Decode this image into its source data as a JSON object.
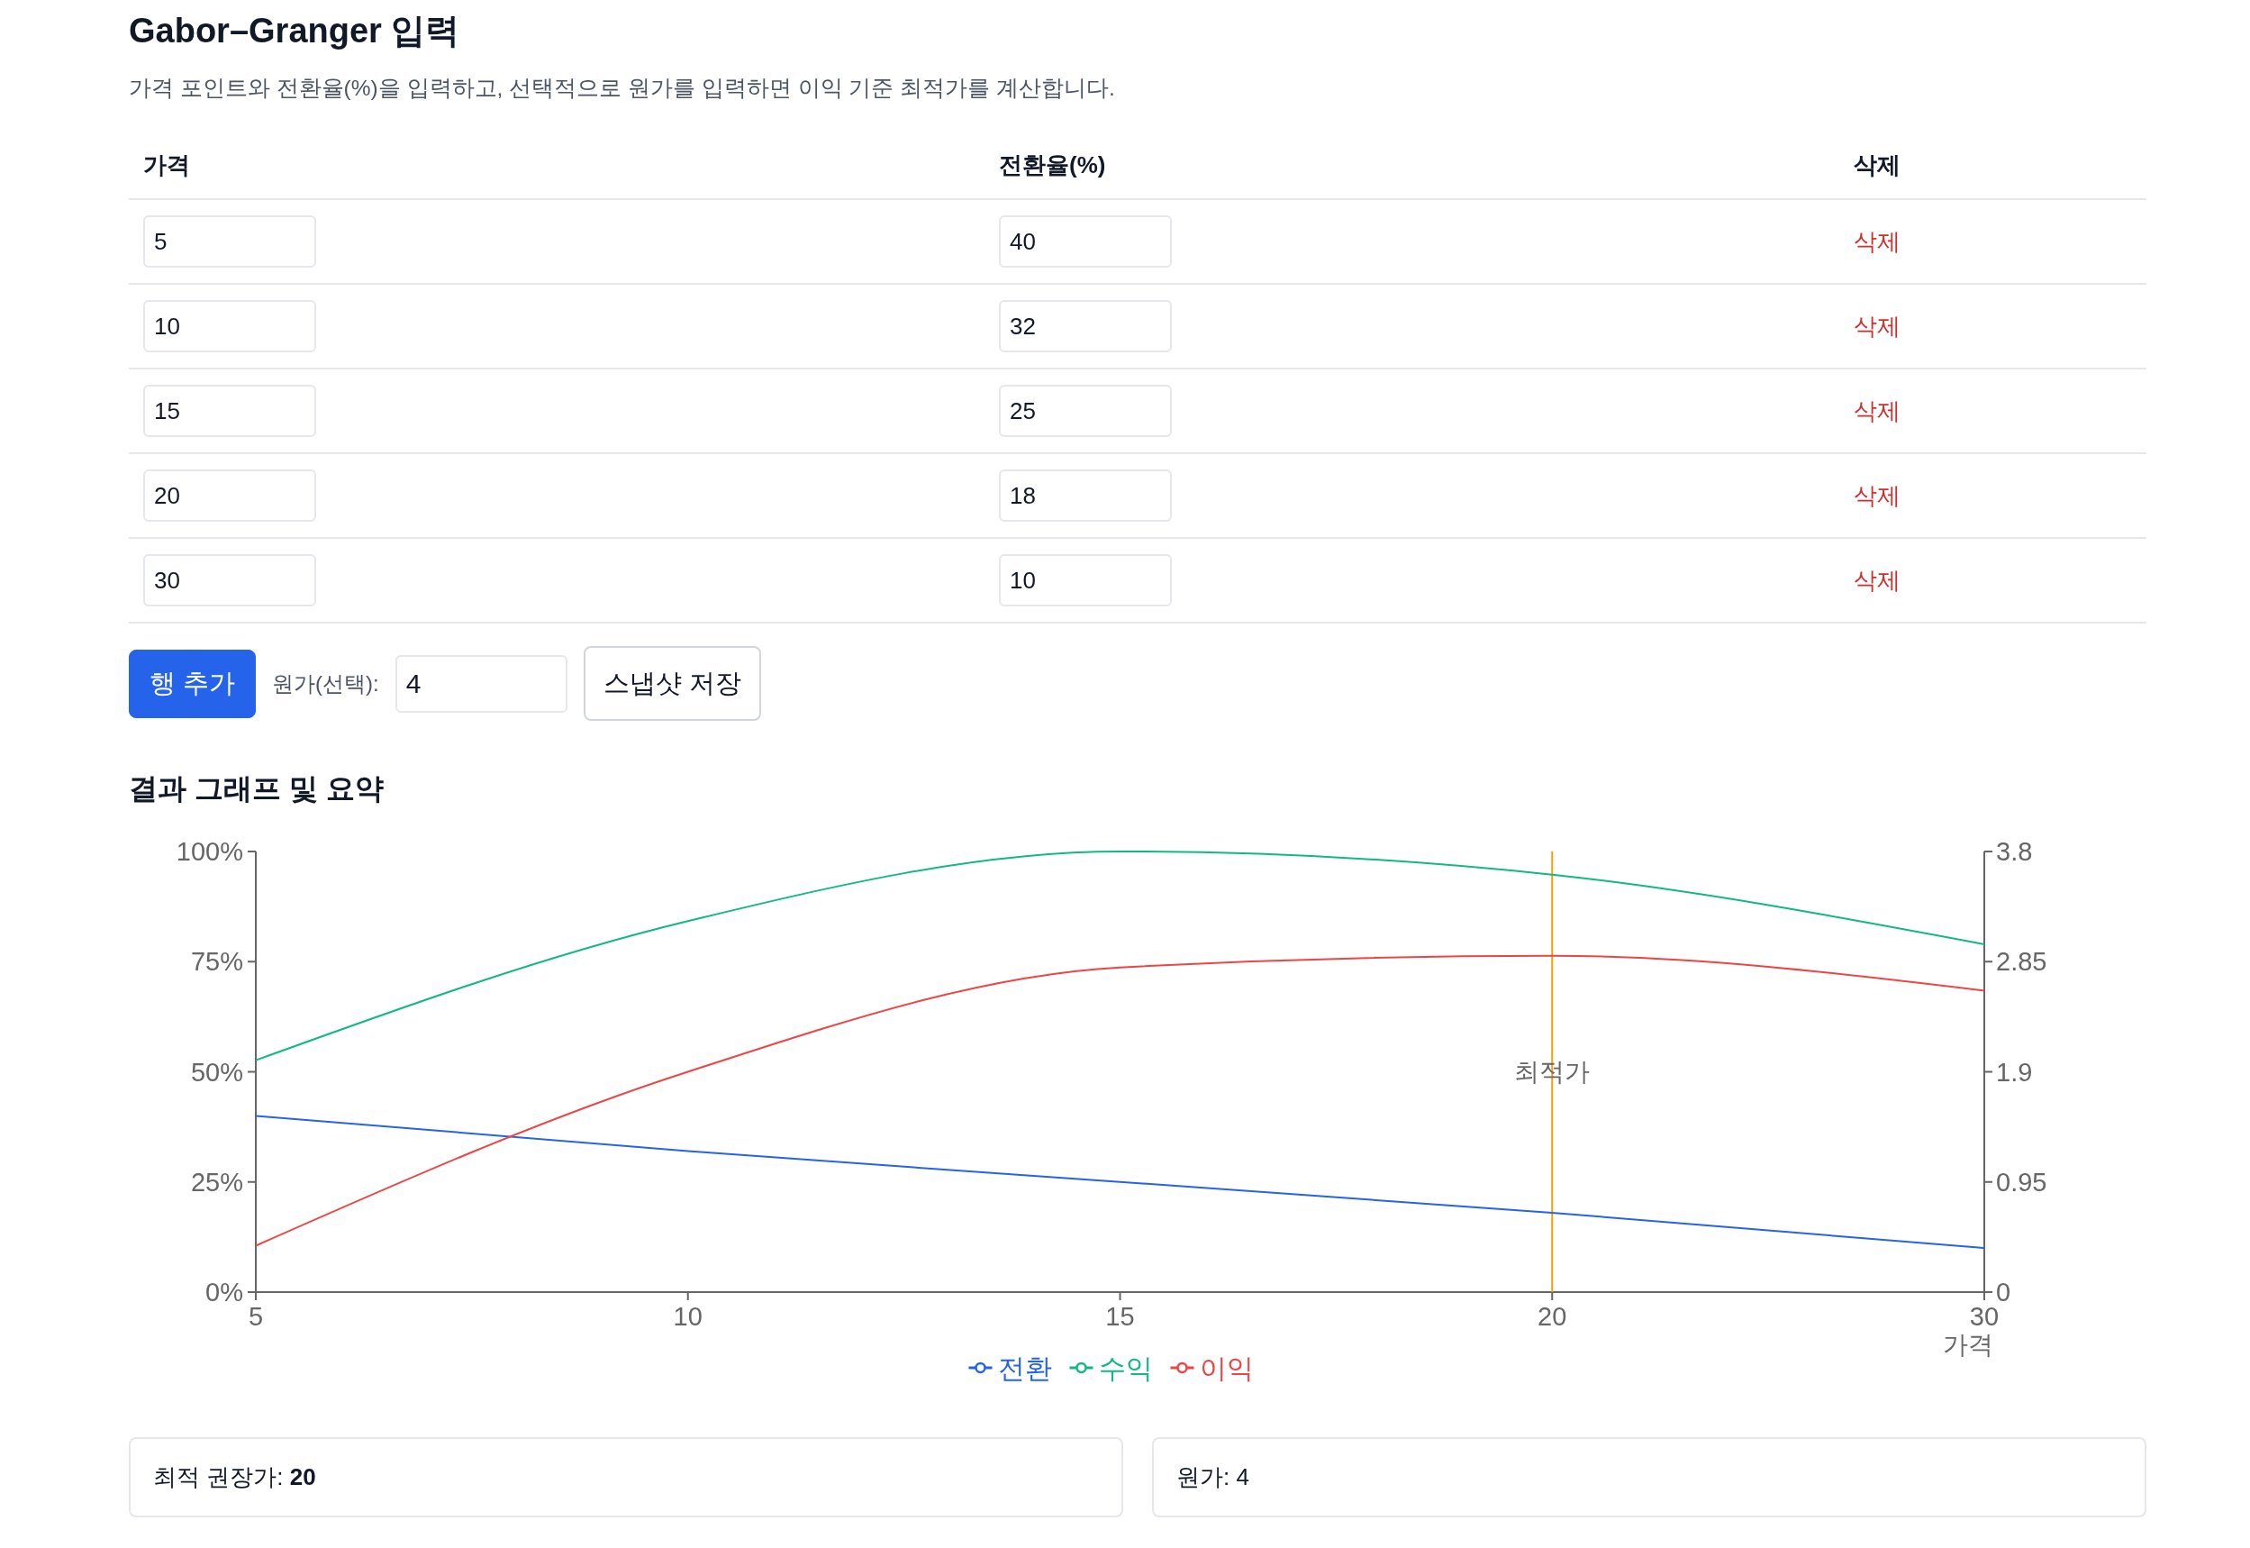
{
  "title": "Gabor–Granger 입력",
  "description": "가격 포인트와 전환율(%)을 입력하고, 선택적으로 원가를 입력하면 이익 기준 최적가를 계산합니다.",
  "table": {
    "columns": [
      "가격",
      "전환율(%)",
      "삭제"
    ],
    "rows": [
      {
        "price": "5",
        "conversion": "40",
        "action": "삭제"
      },
      {
        "price": "10",
        "conversion": "32",
        "action": "삭제"
      },
      {
        "price": "15",
        "conversion": "25",
        "action": "삭제"
      },
      {
        "price": "20",
        "conversion": "18",
        "action": "삭제"
      },
      {
        "price": "30",
        "conversion": "10",
        "action": "삭제"
      }
    ]
  },
  "toolbar": {
    "add_button": "행 추가",
    "cost_label": "원가(선택):",
    "cost_value": "4",
    "snapshot_button": "스냅샷 저장"
  },
  "results": {
    "title": "결과 그래프 및 요약",
    "chart_data": {
      "type": "line",
      "xlabel": "가격",
      "categories": [
        "5",
        "10",
        "15",
        "20",
        "30"
      ],
      "series": [
        {
          "name": "전환",
          "color": "#2563eb",
          "values": [
            40,
            32,
            25,
            18,
            10
          ]
        },
        {
          "name": "수익",
          "color": "#10b981",
          "axis": "y2",
          "values": [
            2,
            3.2,
            3.8,
            3.6,
            3
          ]
        },
        {
          "name": "이익",
          "color": "#ef4444",
          "axis": "y2",
          "values": [
            0.4,
            1.9,
            2.8,
            2.9,
            2.6
          ]
        }
      ],
      "ylim": [
        0,
        100
      ],
      "yticks": [
        {
          "value": 0,
          "label": "0%"
        },
        {
          "value": 25,
          "label": "25%"
        },
        {
          "value": 50,
          "label": "50%"
        },
        {
          "value": 75,
          "label": "75%"
        },
        {
          "value": 100,
          "label": "100%"
        }
      ],
      "y2lim": [
        0,
        3.8
      ],
      "y2ticks": [
        {
          "value": 0,
          "label": "0"
        },
        {
          "value": 0.95,
          "label": "0.95"
        },
        {
          "value": 1.9,
          "label": "1.9"
        },
        {
          "value": 2.85,
          "label": "2.85"
        },
        {
          "value": 3.8,
          "label": "3.8"
        }
      ],
      "ref_lines": [
        {
          "axis": "x",
          "value": "20",
          "label": "최적가",
          "color": "#f59e0b"
        }
      ],
      "legend": "bottom"
    },
    "summary": [
      "최적 권장가: **20**",
      "원가: 4"
    ]
  }
}
